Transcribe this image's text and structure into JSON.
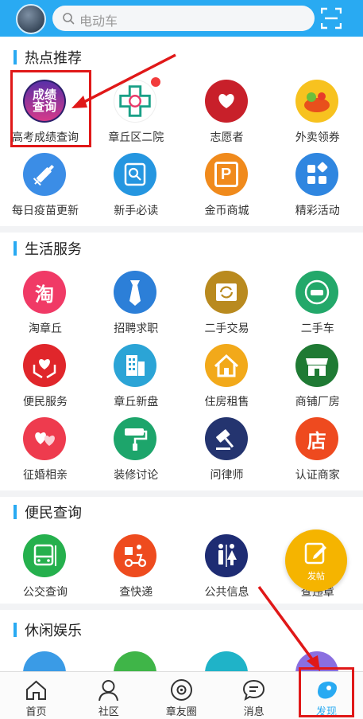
{
  "search": {
    "placeholder": "电动车"
  },
  "sections": [
    {
      "title": "热点推荐",
      "items": [
        {
          "label": "高考成绩查询",
          "icon": "score-query-icon",
          "color": "#2b1f6b",
          "glyph": "成绩查询"
        },
        {
          "label": "章丘区二院",
          "icon": "hospital-logo-icon",
          "color": "#ffffff",
          "glyph": ""
        },
        {
          "label": "志愿者",
          "icon": "volunteer-icon",
          "color": "#c8202a",
          "glyph": ""
        },
        {
          "label": "外卖领券",
          "icon": "takeout-coupon-icon",
          "color": "#f7c21f",
          "glyph": ""
        },
        {
          "label": "每日疫苗更新",
          "icon": "vaccine-syringe-icon",
          "color": "#3b8de6",
          "glyph": ""
        },
        {
          "label": "新手必读",
          "icon": "beginner-guide-icon",
          "color": "#2596e0",
          "glyph": ""
        },
        {
          "label": "金币商城",
          "icon": "coin-mall-icon",
          "color": "#f08a1c",
          "glyph": "P"
        },
        {
          "label": "精彩活动",
          "icon": "activities-icon",
          "color": "#2f86e0",
          "glyph": ""
        }
      ]
    },
    {
      "title": "生活服务",
      "items": [
        {
          "label": "淘章丘",
          "icon": "tao-icon",
          "color": "#f03a66",
          "glyph": "淘"
        },
        {
          "label": "招聘求职",
          "icon": "recruit-tie-icon",
          "color": "#2c7fd8",
          "glyph": ""
        },
        {
          "label": "二手交易",
          "icon": "second-hand-trade-icon",
          "color": "#b98a1f",
          "glyph": ""
        },
        {
          "label": "二手车",
          "icon": "used-car-icon",
          "color": "#23a86a",
          "glyph": ""
        },
        {
          "label": "便民服务",
          "icon": "convenience-service-icon",
          "color": "#e0262b",
          "glyph": ""
        },
        {
          "label": "章丘新盘",
          "icon": "new-property-icon",
          "color": "#2ba4d6",
          "glyph": ""
        },
        {
          "label": "住房租售",
          "icon": "housing-rent-icon",
          "color": "#f2a91a",
          "glyph": ""
        },
        {
          "label": "商铺厂房",
          "icon": "shop-icon",
          "color": "#1f7a34",
          "glyph": ""
        },
        {
          "label": "征婚相亲",
          "icon": "matchmaking-icon",
          "color": "#ee3b4e",
          "glyph": ""
        },
        {
          "label": "装修讨论",
          "icon": "decoration-roller-icon",
          "color": "#1da56b",
          "glyph": ""
        },
        {
          "label": "问律师",
          "icon": "lawyer-gavel-icon",
          "color": "#24346f",
          "glyph": ""
        },
        {
          "label": "认证商家",
          "icon": "certified-merchant-icon",
          "color": "#ee4a1f",
          "glyph": "店"
        }
      ]
    },
    {
      "title": "便民查询",
      "items": [
        {
          "label": "公交查询",
          "icon": "bus-icon",
          "color": "#25b04d",
          "glyph": ""
        },
        {
          "label": "查快递",
          "icon": "express-delivery-icon",
          "color": "#ee4b1e",
          "glyph": ""
        },
        {
          "label": "公共信息",
          "icon": "public-restroom-icon",
          "color": "#1e2c73",
          "glyph": ""
        },
        {
          "label": "查违章",
          "icon": "violation-query-icon",
          "color": "#2a8fe0",
          "glyph": ""
        }
      ]
    },
    {
      "title": "休闲娱乐",
      "items": []
    }
  ],
  "post_button": {
    "label": "发帖"
  },
  "tabs": [
    {
      "label": "首页",
      "icon": "home-icon"
    },
    {
      "label": "社区",
      "icon": "community-icon"
    },
    {
      "label": "章友圈",
      "icon": "friends-circle-icon"
    },
    {
      "label": "消息",
      "icon": "message-icon"
    },
    {
      "label": "发现",
      "icon": "discover-icon"
    }
  ],
  "colors": {
    "accent": "#29aaf2",
    "highlight": "#e01818"
  }
}
